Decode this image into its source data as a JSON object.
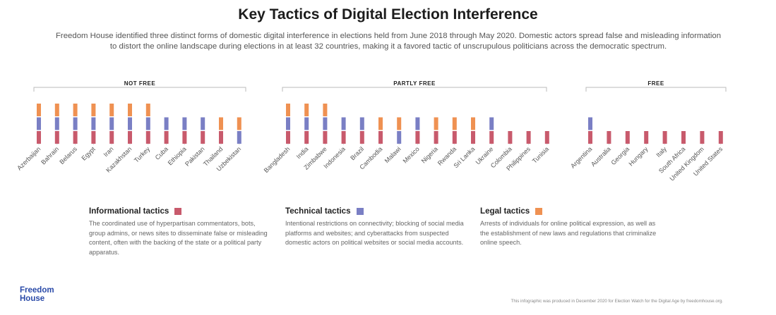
{
  "title": "Key Tactics of Digital Election Interference",
  "subtitle": "Freedom House identified three distinct forms of domestic digital interference in elections held from June 2018 through May 2020. Domestic actors spread false and misleading information to distort the online landscape during elections in at least 32 countries, making it a favored tactic of unscrupulous politicians across the democratic spectrum.",
  "colors": {
    "informational": "#c85a6c",
    "technical": "#7a7fc4",
    "legal": "#ef9152",
    "bracket": "#bbbbbb",
    "label": "#555555"
  },
  "legend": [
    {
      "label": "Informational tactics",
      "color": "#c85a6c",
      "description": "The coordinated use of hyperpartisan commentators, bots, group admins, or news sites to disseminate false or misleading content, often with the backing of the state or a political party apparatus."
    },
    {
      "label": "Technical tactics",
      "color": "#7a7fc4",
      "description": "Intentional restrictions on connectivity; blocking of social media platforms and websites; and cyberattacks from suspected domestic actors on political websites or social media accounts."
    },
    {
      "label": "Legal tactics",
      "color": "#ef9152",
      "description": "Arrests of individuals for online political expression, as well as the establishment of new laws and regulations that criminalize online speech."
    }
  ],
  "footer": {
    "logo_line1": "Freedom",
    "logo_line2": "House",
    "credit": "This infographic was produced in December 2020 for Election Watch for the Digital Age by freedomhouse.org."
  },
  "chart_data": {
    "type": "bar",
    "stacked": true,
    "series_order": [
      "Informational tactics",
      "Technical tactics",
      "Legal tactics"
    ],
    "groups": [
      {
        "name": "NOT FREE",
        "countries": [
          {
            "name": "Azerbaijan",
            "informational": 1,
            "technical": 1,
            "legal": 1
          },
          {
            "name": "Bahrain",
            "informational": 1,
            "technical": 1,
            "legal": 1
          },
          {
            "name": "Belarus",
            "informational": 1,
            "technical": 1,
            "legal": 1
          },
          {
            "name": "Egypt",
            "informational": 1,
            "technical": 1,
            "legal": 1
          },
          {
            "name": "Iran",
            "informational": 1,
            "technical": 1,
            "legal": 1
          },
          {
            "name": "Kazakhstan",
            "informational": 1,
            "technical": 1,
            "legal": 1
          },
          {
            "name": "Turkey",
            "informational": 1,
            "technical": 1,
            "legal": 1
          },
          {
            "name": "Cuba",
            "informational": 1,
            "technical": 1,
            "legal": 0
          },
          {
            "name": "Ethiopia",
            "informational": 1,
            "technical": 1,
            "legal": 0
          },
          {
            "name": "Pakistan",
            "informational": 1,
            "technical": 1,
            "legal": 0
          },
          {
            "name": "Thailand",
            "informational": 1,
            "technical": 0,
            "legal": 1
          },
          {
            "name": "Uzbekistan",
            "informational": 0,
            "technical": 1,
            "legal": 1
          }
        ]
      },
      {
        "name": "PARTLY FREE",
        "countries": [
          {
            "name": "Bangladesh",
            "informational": 1,
            "technical": 1,
            "legal": 1
          },
          {
            "name": "India",
            "informational": 1,
            "technical": 1,
            "legal": 1
          },
          {
            "name": "Zimbabwe",
            "informational": 1,
            "technical": 1,
            "legal": 1
          },
          {
            "name": "Indonesia",
            "informational": 1,
            "technical": 1,
            "legal": 0
          },
          {
            "name": "Brazil",
            "informational": 1,
            "technical": 1,
            "legal": 0
          },
          {
            "name": "Cambodia",
            "informational": 1,
            "technical": 0,
            "legal": 1
          },
          {
            "name": "Malawi",
            "informational": 0,
            "technical": 1,
            "legal": 1
          },
          {
            "name": "Mexico",
            "informational": 1,
            "technical": 1,
            "legal": 0
          },
          {
            "name": "Nigeria",
            "informational": 1,
            "technical": 0,
            "legal": 1
          },
          {
            "name": "Rwanda",
            "informational": 1,
            "technical": 0,
            "legal": 1
          },
          {
            "name": "Sri Lanka",
            "informational": 1,
            "technical": 0,
            "legal": 1
          },
          {
            "name": "Ukraine",
            "informational": 1,
            "technical": 1,
            "legal": 0
          },
          {
            "name": "Colombia",
            "informational": 1,
            "technical": 0,
            "legal": 0
          },
          {
            "name": "Philippines",
            "informational": 1,
            "technical": 0,
            "legal": 0
          },
          {
            "name": "Tunisia",
            "informational": 1,
            "technical": 0,
            "legal": 0
          }
        ]
      },
      {
        "name": "FREE",
        "countries": [
          {
            "name": "Argentina",
            "informational": 1,
            "technical": 1,
            "legal": 0
          },
          {
            "name": "Australia",
            "informational": 1,
            "technical": 0,
            "legal": 0
          },
          {
            "name": "Georgia",
            "informational": 1,
            "technical": 0,
            "legal": 0
          },
          {
            "name": "Hungary",
            "informational": 1,
            "technical": 0,
            "legal": 0
          },
          {
            "name": "Italy",
            "informational": 1,
            "technical": 0,
            "legal": 0
          },
          {
            "name": "South Africa",
            "informational": 1,
            "technical": 0,
            "legal": 0
          },
          {
            "name": "United Kingdom",
            "informational": 1,
            "technical": 0,
            "legal": 0
          },
          {
            "name": "United States",
            "informational": 1,
            "technical": 0,
            "legal": 0
          }
        ]
      }
    ]
  }
}
